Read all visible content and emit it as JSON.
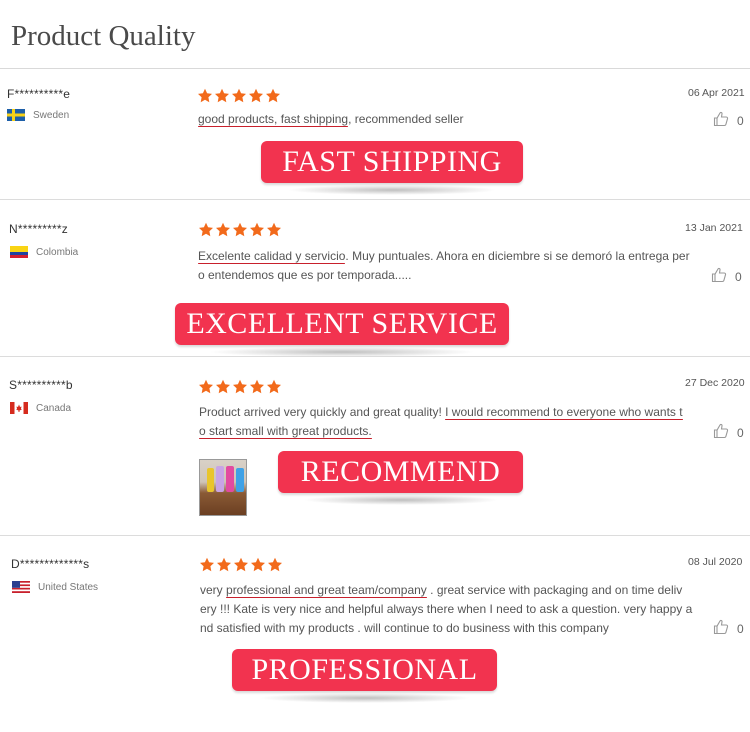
{
  "page": {
    "title": "Product Quality"
  },
  "colors": {
    "star": "#f26a1b",
    "banner": "#f2334f",
    "underline": "#c8202c"
  },
  "reviews": [
    {
      "user": "F**********e",
      "country": "Sweden",
      "flag": "flag-sweden-icon",
      "rating": 5,
      "date": "06 Apr 2021",
      "lines": [
        [
          {
            "t": "good products, fast shipping",
            "hl": true
          },
          {
            "t": ", recommended seller",
            "hl": false
          }
        ]
      ],
      "likes": "0",
      "banner": "FAST SHIPPING"
    },
    {
      "user": "N*********z",
      "country": "Colombia",
      "flag": "flag-colombia-icon",
      "rating": 5,
      "date": "13 Jan 2021",
      "lines": [
        [
          {
            "t": "Excelente calidad y servicio",
            "hl": true
          },
          {
            "t": ". Muy puntuales. Ahora en diciembre si se demoró la entrega per",
            "hl": false
          }
        ],
        [
          {
            "t": "o entendemos que es por temporada.....",
            "hl": false
          }
        ]
      ],
      "likes": "0",
      "banner": "EXCELLENT SERVICE"
    },
    {
      "user": "S**********b",
      "country": "Canada",
      "flag": "flag-canada-icon",
      "rating": 5,
      "date": "27 Dec 2020",
      "lines": [
        [
          {
            "t": "Product arrived very quickly and great quality! ",
            "hl": false
          },
          {
            "t": "I would recommend to everyone who wants t",
            "hl": true
          }
        ],
        [
          {
            "t": "o start small with great products.",
            "hl": true
          }
        ]
      ],
      "likes": "0",
      "banner": "RECOMMEND"
    },
    {
      "user": "D*************s",
      "country": "United States",
      "flag": "flag-united-states-icon",
      "rating": 5,
      "date": "08 Jul 2020",
      "lines": [
        [
          {
            "t": "very ",
            "hl": false
          },
          {
            "t": "professional and great team/company",
            "hl": true
          },
          {
            "t": " . great service with packaging and on time deliv",
            "hl": false
          }
        ],
        [
          {
            "t": "ery !!! Kate is very nice and helpful always there when I need to ask a question. very happy a",
            "hl": false
          }
        ],
        [
          {
            "t": "nd satisfied with my products . will continue to do  business with this company",
            "hl": false
          }
        ]
      ],
      "likes": "0",
      "banner": "PROFESSIONAL"
    }
  ]
}
